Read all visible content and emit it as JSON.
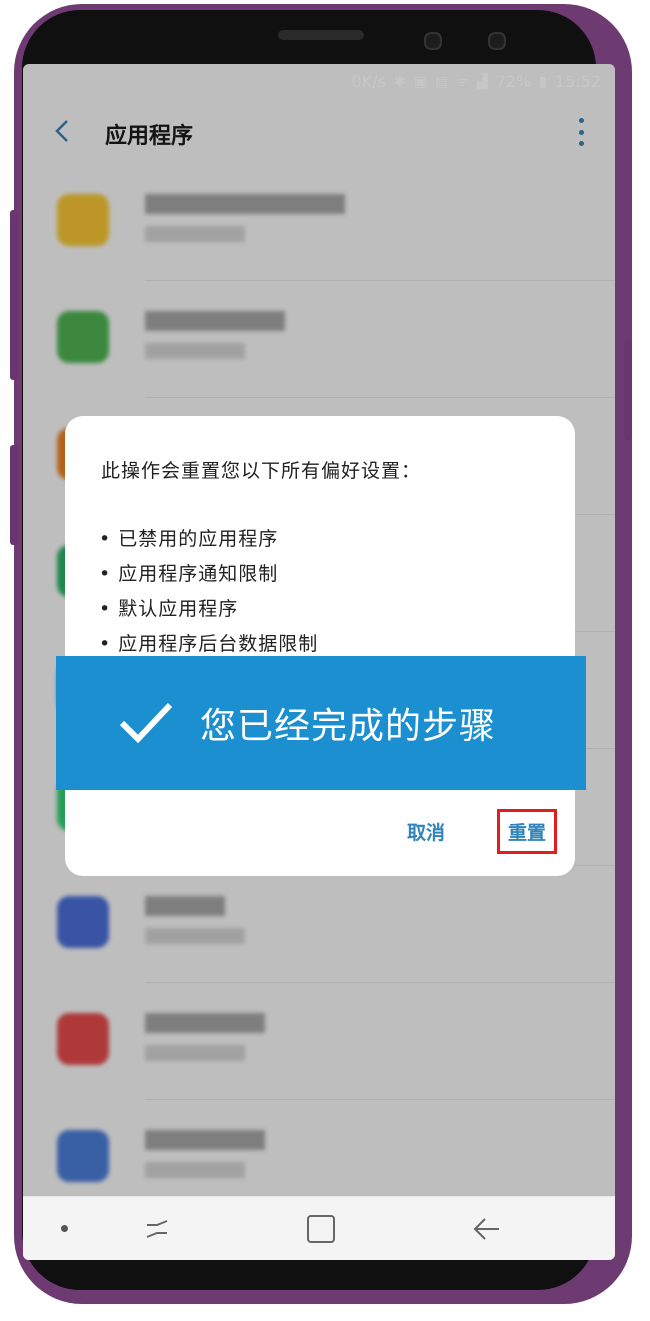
{
  "status_bar": {
    "speed": "0K/s",
    "icons": [
      "bluetooth-icon",
      "nfc-icon",
      "image-icon",
      "wifi-icon",
      "signal-icon"
    ],
    "battery": "72%",
    "time": "15:52"
  },
  "app_bar": {
    "title": "应用程序",
    "back_icon": "back-arrow-icon",
    "menu_icon": "more-vertical-icon"
  },
  "dialog": {
    "message": "此操作会重置您以下所有偏好设置：",
    "items": [
      "已禁用的应用程序",
      "应用程序通知限制",
      "默认应用程序",
      "应用程序后台数据限制"
    ],
    "cancel_label": "取消",
    "reset_label": "重置",
    "highlight_color": "#e31d1d"
  },
  "banner": {
    "text": "您已经完成的步骤",
    "icon": "checkmark-icon",
    "color": "#1b8fd0"
  },
  "nav_bar": {
    "icons": [
      "dot-icon",
      "recent-apps-icon",
      "home-icon",
      "back-icon"
    ]
  }
}
